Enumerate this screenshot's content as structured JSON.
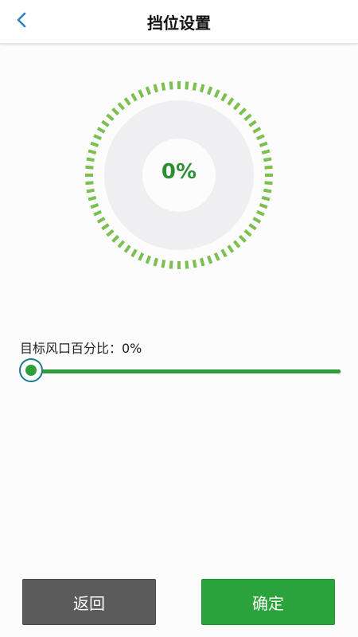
{
  "header": {
    "title": "挡位设置",
    "back_icon": "chevron-left-icon"
  },
  "gauge": {
    "value_text": "0%",
    "percent": 0,
    "tick_color": "#7bbf4f",
    "ring_color": "#efeff1"
  },
  "slider": {
    "label": "目标风口百分比：0%",
    "value": 0,
    "track_color": "#2e9e3a"
  },
  "footer": {
    "back_label": "返回",
    "confirm_label": "确定"
  }
}
